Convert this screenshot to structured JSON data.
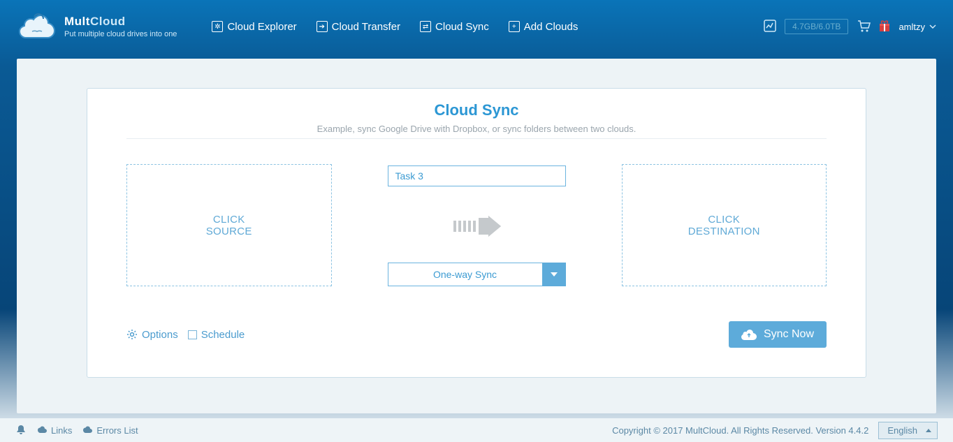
{
  "header": {
    "brand_mult": "Mult",
    "brand_cloud": "Cloud",
    "tagline": "Put multiple cloud drives into one",
    "nav": {
      "explorer": "Cloud Explorer",
      "transfer": "Cloud Transfer",
      "sync": "Cloud Sync",
      "add": "Add Clouds"
    },
    "storage": "4.7GB/6.0TB",
    "user": "amltzy"
  },
  "sync": {
    "title": "Cloud Sync",
    "subtitle": "Example, sync Google Drive with Dropbox, or sync folders between two clouds.",
    "source_l1": "CLICK",
    "source_l2": "SOURCE",
    "dest_l1": "CLICK",
    "dest_l2": "DESTINATION",
    "task_name": "Task 3",
    "mode": "One-way Sync",
    "options": "Options",
    "schedule": "Schedule",
    "button": "Sync Now"
  },
  "footer": {
    "links": "Links",
    "errors": "Errors List",
    "copyright": "Copyright © 2017 MultCloud. All Rights Reserved. Version 4.4.2",
    "language": "English"
  }
}
